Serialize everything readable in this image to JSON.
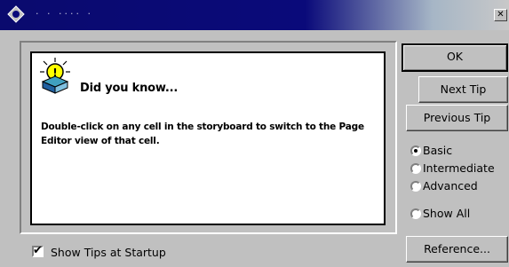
{
  "window": {
    "title": "· · ···· ·",
    "close_glyph": "✕"
  },
  "tip": {
    "heading": "Did you know...",
    "body": "Double-click on any cell in the storyboard to switch to the Page Editor view of that cell."
  },
  "buttons": {
    "ok": "OK",
    "next_tip": "Next Tip",
    "previous_tip": "Previous Tip",
    "reference": "Reference..."
  },
  "levels": [
    {
      "label": "Basic",
      "selected": true
    },
    {
      "label": "Intermediate",
      "selected": false
    },
    {
      "label": "Advanced",
      "selected": false
    },
    {
      "label": "Show All",
      "selected": false
    }
  ],
  "show_tips": {
    "label": "Show Tips at Startup",
    "checked": true
  },
  "colors": {
    "titlebar": "#0a0a7a",
    "bulb": "#ffff00",
    "panel": "#ffffff"
  }
}
